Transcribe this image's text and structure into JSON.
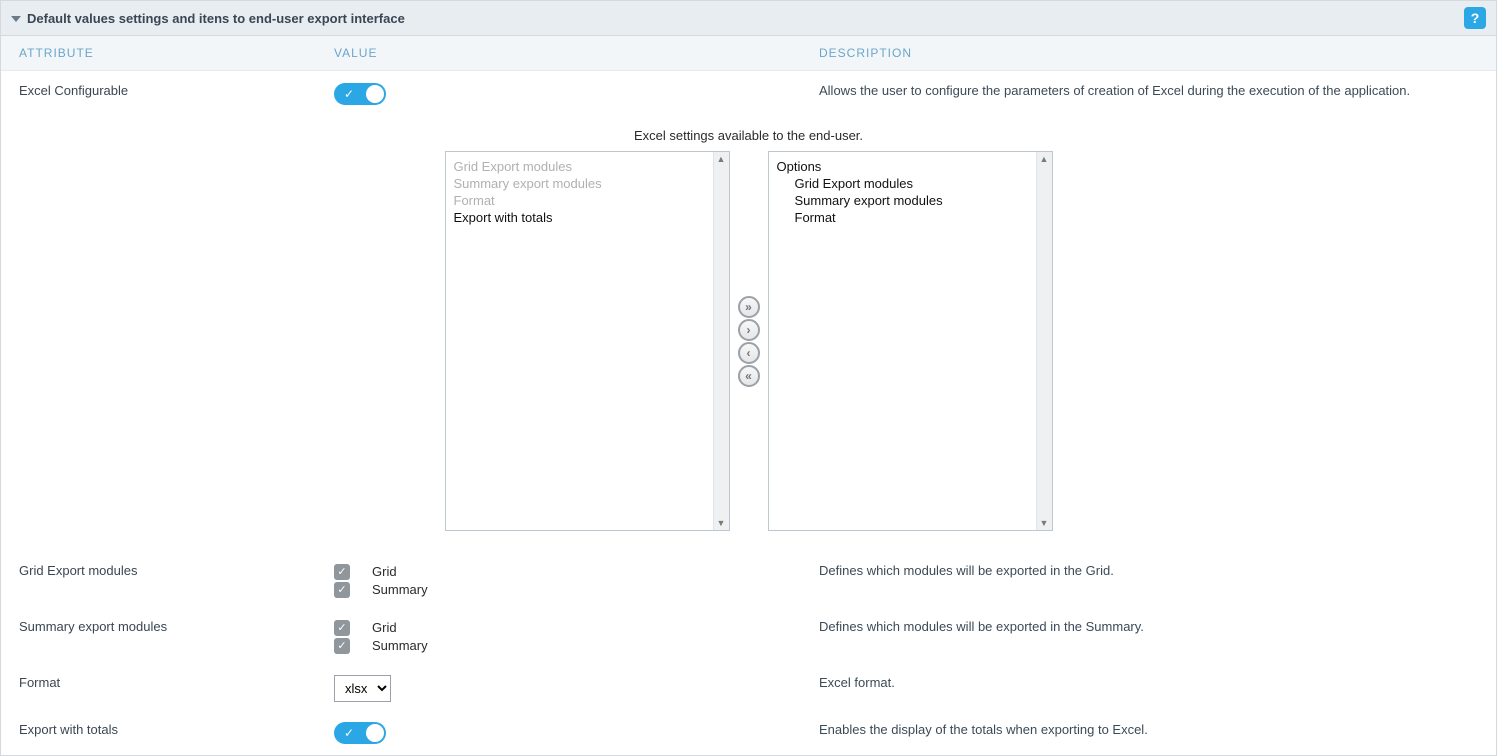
{
  "panel": {
    "title": "Default values settings and itens to end-user export interface",
    "help": "?"
  },
  "columns": {
    "attribute": "ATTRIBUTE",
    "value": "VALUE",
    "description": "DESCRIPTION"
  },
  "rows": {
    "excel_configurable": {
      "label": "Excel Configurable",
      "desc": "Allows the user to configure the parameters of creation of Excel during the execution of the application."
    },
    "grid_modules": {
      "label": "Grid Export modules",
      "desc": "Defines which modules will be exported in the Grid.",
      "option_grid": "Grid",
      "option_summary": "Summary"
    },
    "summary_modules": {
      "label": "Summary export modules",
      "desc": "Defines which modules will be exported in the Summary.",
      "option_grid": "Grid",
      "option_summary": "Summary"
    },
    "format": {
      "label": "Format",
      "desc": "Excel format.",
      "value": "xlsx"
    },
    "export_totals": {
      "label": "Export with totals",
      "desc": "Enables the display of the totals when exporting to Excel."
    }
  },
  "picklist": {
    "caption": "Excel settings available to the end-user.",
    "left": {
      "item0": "Grid Export modules",
      "item1": "Summary export modules",
      "item2": "Format",
      "item3": "Export with totals"
    },
    "right": {
      "header": "Options",
      "item0": "Grid Export modules",
      "item1": "Summary export modules",
      "item2": "Format"
    }
  }
}
